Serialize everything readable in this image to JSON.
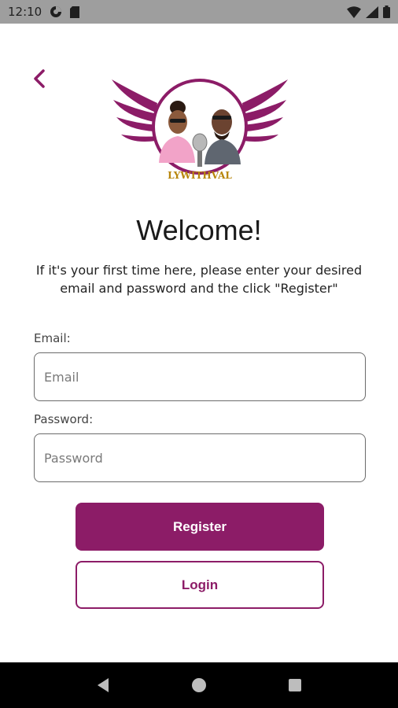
{
  "status_bar": {
    "time": "12:10",
    "left_icons": [
      "data-saver-icon",
      "sd-card-icon"
    ],
    "right_icons": [
      "wifi-icon",
      "cellular-signal-icon",
      "battery-icon"
    ]
  },
  "header": {
    "back_icon": "chevron-left-icon",
    "logo_text": "LYWITHVAL"
  },
  "welcome": {
    "title": "Welcome!",
    "message": "If it's your first time here, please enter your desired email and password and the click \"Register\""
  },
  "form": {
    "email_label": "Email:",
    "email_placeholder": "Email",
    "email_value": "",
    "password_label": "Password:",
    "password_placeholder": "Password",
    "password_value": ""
  },
  "actions": {
    "register_label": "Register",
    "login_label": "Login"
  },
  "nav_bar": {
    "icons": [
      "back-triangle-icon",
      "home-circle-icon",
      "recents-square-icon"
    ]
  },
  "colors": {
    "brand": "#8c1c67",
    "status_bar": "#9e9e9e",
    "nav_bar": "#000000"
  }
}
